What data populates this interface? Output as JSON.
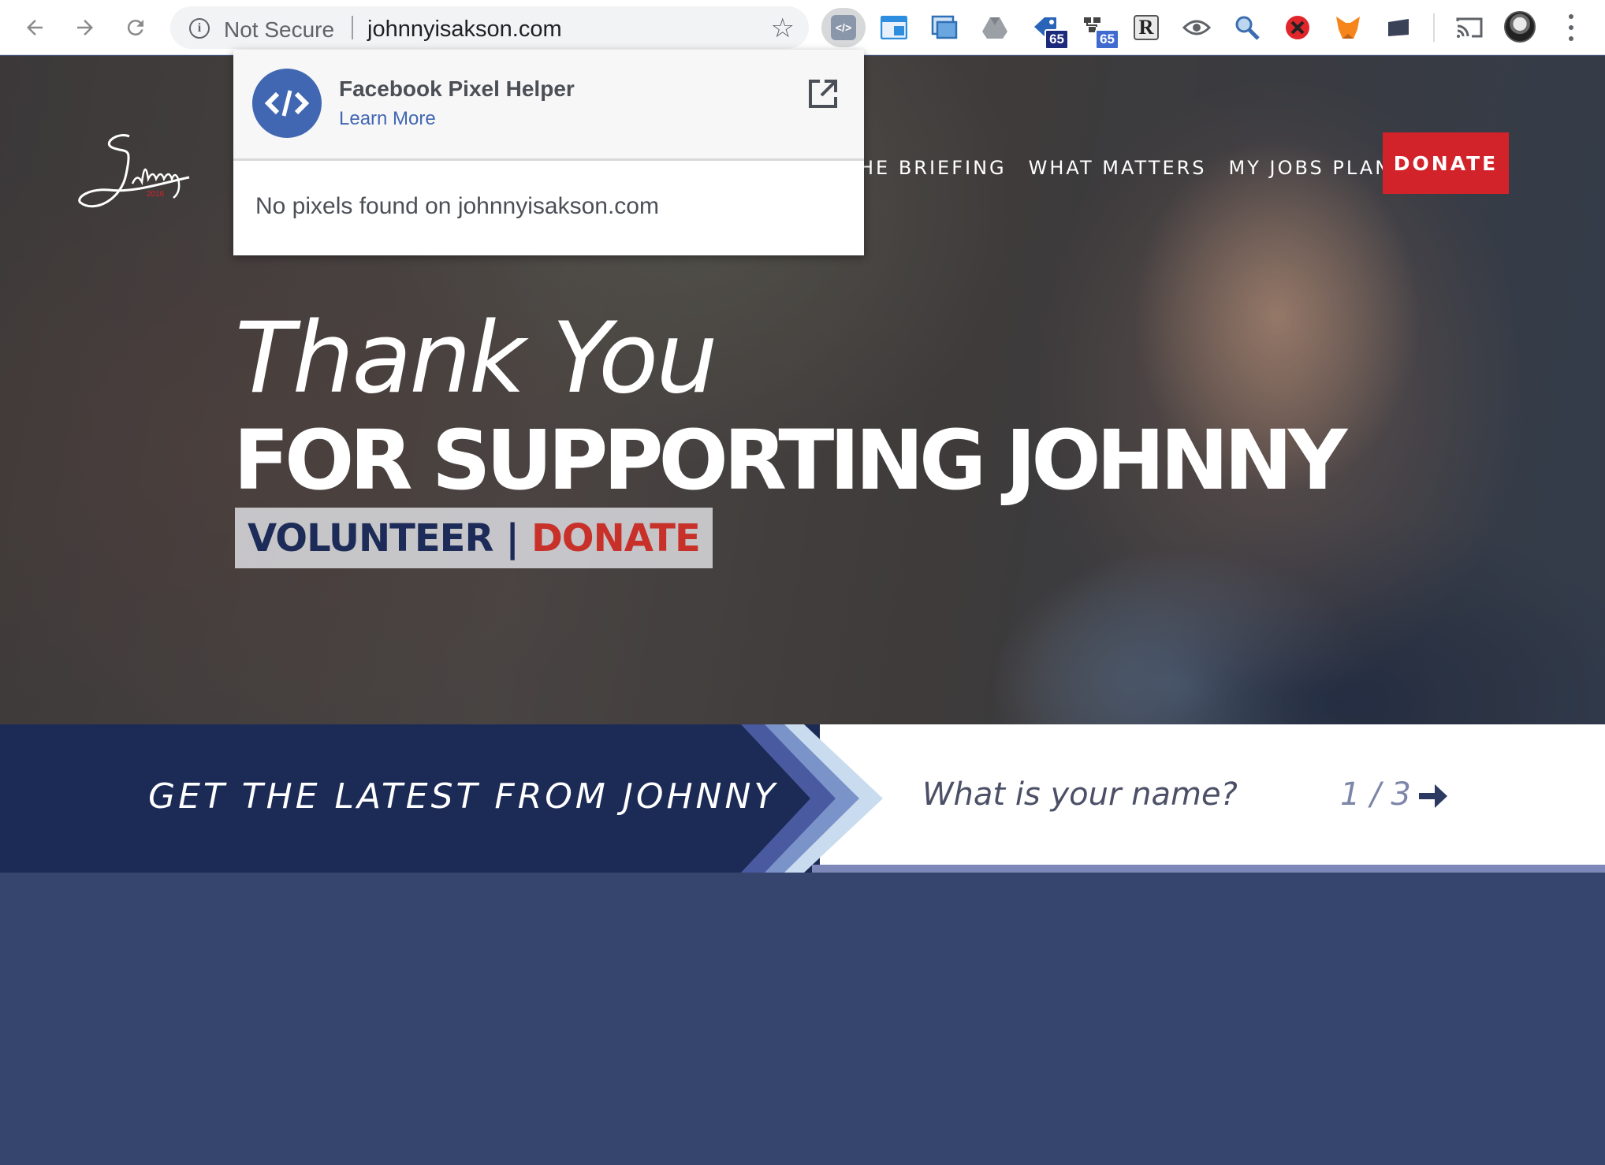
{
  "browser": {
    "security_label": "Not Secure",
    "url": "johnnyisakson.com",
    "extensions": [
      {
        "name": "facebook-pixel-helper-icon",
        "active": true
      },
      {
        "name": "window-icon"
      },
      {
        "name": "screenshot-icon"
      },
      {
        "name": "drive-icon"
      },
      {
        "name": "tag-icon",
        "badge": "65"
      },
      {
        "name": "sitemap-icon",
        "badge": "65"
      },
      {
        "name": "r-icon"
      },
      {
        "name": "eye-icon"
      },
      {
        "name": "magnifier-icon"
      },
      {
        "name": "blocker-icon"
      },
      {
        "name": "fox-icon"
      },
      {
        "name": "card-icon"
      }
    ]
  },
  "popup": {
    "title": "Facebook Pixel Helper",
    "learn_more": "Learn More",
    "message": "No pixels found on johnnyisakson.com"
  },
  "site": {
    "logo_text": "Johnny",
    "nav": [
      "HE BRIEFING",
      "WHAT MATTERS",
      "MY JOBS PLAN"
    ],
    "donate_button": "DONATE",
    "hero": {
      "line1": "Thank You",
      "line2": "FOR SUPPORTING JOHNNY",
      "volunteer": "VOLUNTEER",
      "separator": "|",
      "donate": "DONATE"
    },
    "signup": {
      "title": "GET THE LATEST FROM JOHNNY",
      "placeholder": "What is your name?",
      "step": "1 / 3"
    }
  },
  "colors": {
    "navy": "#1c2b56",
    "donate_red": "#d2232a",
    "lower_bg": "#36456e",
    "facebook_blue": "#4267b2"
  }
}
